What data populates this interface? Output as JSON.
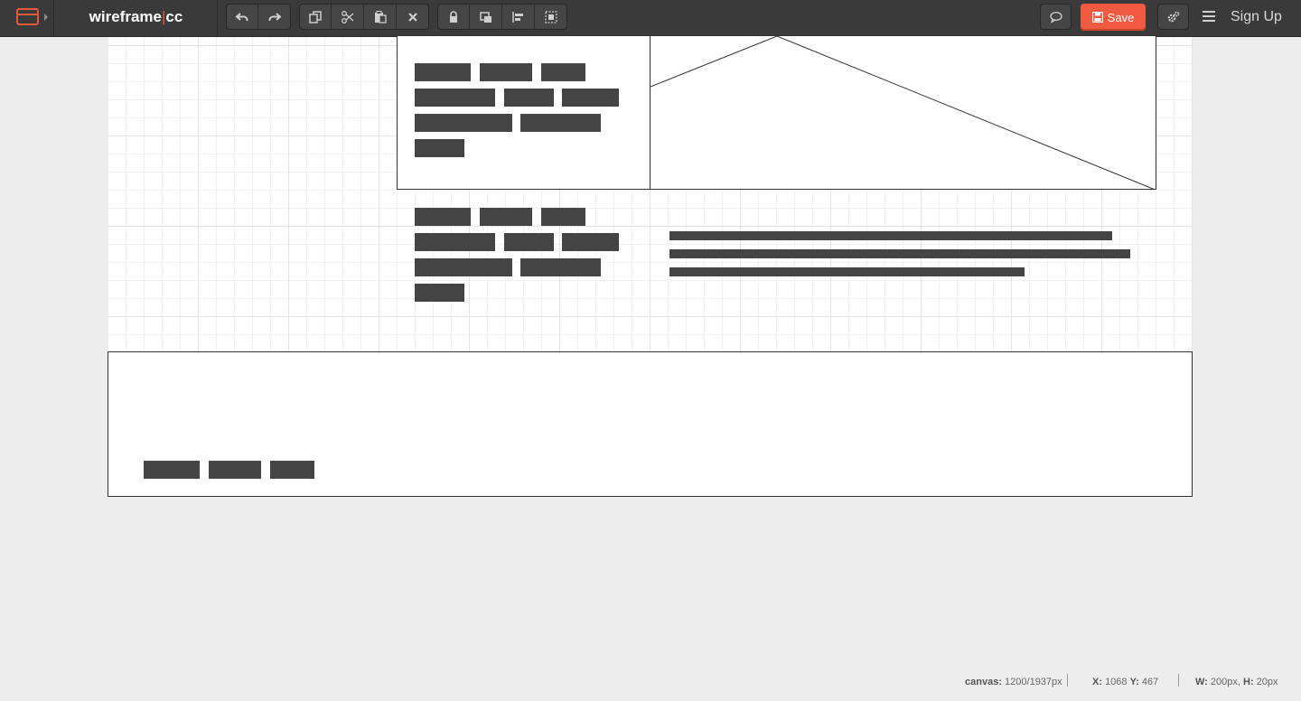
{
  "app": {
    "brand_left": "wireframe",
    "brand_sep": "|",
    "brand_right": "cc"
  },
  "toolbar": {
    "history": [
      {
        "name": "undo-button",
        "icon": "undo-icon"
      },
      {
        "name": "redo-button",
        "icon": "redo-icon"
      }
    ],
    "edit": [
      {
        "name": "copy-button",
        "icon": "copy-icon"
      },
      {
        "name": "cut-button",
        "icon": "scissors-icon"
      },
      {
        "name": "paste-button",
        "icon": "paste-icon"
      },
      {
        "name": "delete-button",
        "icon": "close-icon"
      }
    ],
    "arrange": [
      {
        "name": "lock-button",
        "icon": "lock-icon"
      },
      {
        "name": "layer-button",
        "icon": "layers-icon"
      },
      {
        "name": "align-button",
        "icon": "align-left-icon"
      },
      {
        "name": "group-button",
        "icon": "group-icon"
      }
    ],
    "save_label": "Save",
    "signup_label": "Sign Up"
  },
  "status": {
    "canvas_label": "canvas:",
    "canvas_value": "1200/1937px",
    "x_label": "X:",
    "x_value": "1068",
    "y_label": "Y:",
    "y_value": "467",
    "w_label": "W:",
    "w_value": "200px,",
    "h_label": "H:",
    "h_value": "20px"
  },
  "colors": {
    "accent": "#f05a40",
    "toolbar": "#3a3a3a",
    "wire": "#444444"
  }
}
